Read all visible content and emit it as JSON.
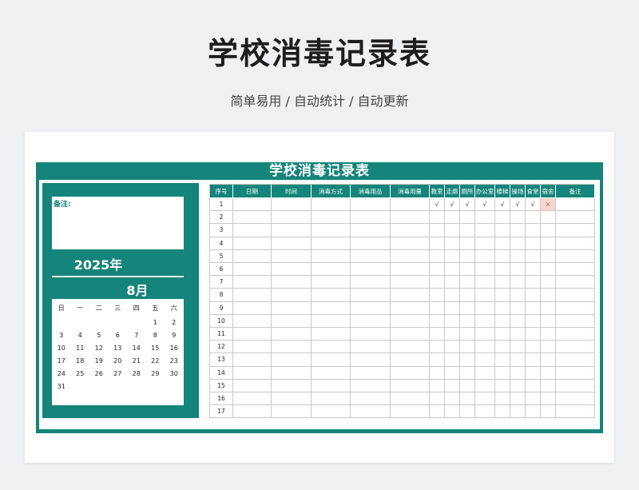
{
  "page": {
    "title": "学校消毒记录表",
    "subtitle": "简单易用 / 自动统计 / 自动更新"
  },
  "sheet": {
    "title": "学校消毒记录表",
    "note_label": "备注:",
    "year": "2025年",
    "month": "8月",
    "weekdays": [
      "日",
      "一",
      "二",
      "三",
      "四",
      "五",
      "六"
    ],
    "calendar_rows": [
      [
        "",
        "",
        "",
        "",
        "",
        "1",
        "2"
      ],
      [
        "3",
        "4",
        "5",
        "6",
        "7",
        "8",
        "9"
      ],
      [
        "10",
        "11",
        "12",
        "13",
        "14",
        "15",
        "16"
      ],
      [
        "17",
        "18",
        "19",
        "20",
        "21",
        "22",
        "23"
      ],
      [
        "24",
        "25",
        "26",
        "27",
        "28",
        "29",
        "30"
      ],
      [
        "31",
        "",
        "",
        "",
        "",
        "",
        ""
      ]
    ],
    "columns": [
      "序号",
      "日期",
      "时间",
      "消毒方式",
      "消毒用品",
      "消毒用量",
      "教室",
      "走廊",
      "厕所",
      "办公室",
      "楼梯",
      "操场",
      "食堂",
      "宿舍",
      "备注"
    ],
    "rows": [
      [
        "1",
        "",
        "",
        "",
        "",
        "",
        "√",
        "√",
        "√",
        "√",
        "√",
        "√",
        "√",
        "×",
        ""
      ],
      [
        "2"
      ],
      [
        "3"
      ],
      [
        "4"
      ],
      [
        "5"
      ],
      [
        "6"
      ],
      [
        "7"
      ],
      [
        "8"
      ],
      [
        "9"
      ],
      [
        "10"
      ],
      [
        "11"
      ],
      [
        "12"
      ],
      [
        "13"
      ],
      [
        "14"
      ],
      [
        "15"
      ],
      [
        "16"
      ],
      [
        "17"
      ]
    ]
  }
}
